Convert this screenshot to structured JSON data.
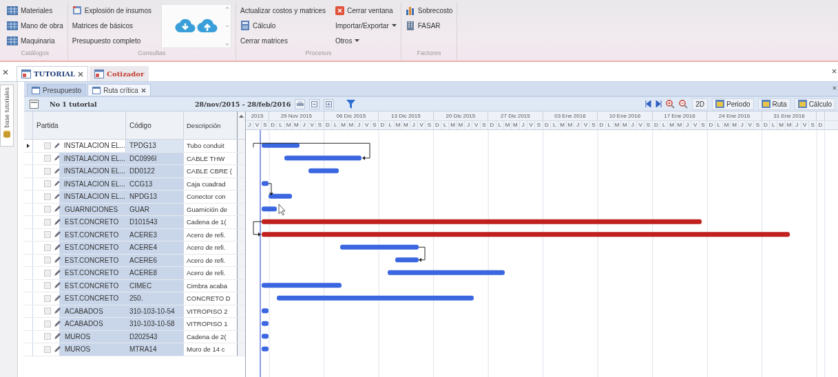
{
  "ribbon": {
    "groups": [
      {
        "label": "Catálogos",
        "items": [
          {
            "kind": "with-icon",
            "label": "Materiales"
          },
          {
            "kind": "with-icon",
            "label": "Mano de obra"
          },
          {
            "kind": "with-icon",
            "label": "Maquinaria"
          }
        ]
      },
      {
        "label": "Consultas",
        "items": [
          {
            "kind": "with-icon",
            "label": "Explosión de insumos"
          },
          {
            "kind": "plain",
            "label": "Matrices de básicos"
          },
          {
            "kind": "plain",
            "label": "Presupuesto completo"
          },
          {
            "kind": "gallery"
          }
        ]
      },
      {
        "label": "Procesos",
        "items": [
          {
            "kind": "plain",
            "label": "Actualizar costos y matrices"
          },
          {
            "kind": "with-icon",
            "label": "Cálculo"
          },
          {
            "kind": "plain",
            "label": "Cerrar matrices"
          },
          {
            "kind": "with-icon",
            "label": "Cerrar ventana"
          },
          {
            "kind": "menu",
            "label": "Importar/Exportar"
          },
          {
            "kind": "menu",
            "label": "Otros"
          }
        ]
      },
      {
        "label": "Factores",
        "items": [
          {
            "kind": "with-icon",
            "label": "Sobrecosto"
          },
          {
            "kind": "with-icon",
            "label": "FASAR"
          }
        ]
      }
    ]
  },
  "doc_tabs": [
    {
      "label": "TUTORIAL",
      "selected": true,
      "closable": true,
      "color": "#1f3c78"
    },
    {
      "label": "Cotizador",
      "selected": false,
      "closable": false,
      "color": "#c0392b"
    }
  ],
  "sub_tabs": [
    {
      "label": "Presupuesto",
      "selected": false,
      "closable": false
    },
    {
      "label": "Ruta crítica",
      "selected": true,
      "closable": true
    }
  ],
  "side_panel": {
    "label": "base tutoriales"
  },
  "toolbar": {
    "title": "No 1 tutorial",
    "date_range": "28/nov/2015 - 28/feb/2016",
    "buttons": [
      {
        "label": "2D"
      },
      {
        "label": "Periodo"
      },
      {
        "label": "Ruta"
      },
      {
        "label": "Cálculo"
      }
    ]
  },
  "table": {
    "columns": [
      "Partida",
      "Código",
      "Descripción"
    ],
    "rows": [
      {
        "partida": "INSTALACION EL...",
        "codigo": "TPDG13",
        "descripcion": "Tubo conduit",
        "selected": true,
        "checked": false,
        "critical": false
      },
      {
        "partida": "INSTALACION EL...",
        "codigo": "DC0996I",
        "descripcion": "CABLE THW",
        "selected": false,
        "checked": false,
        "critical": false
      },
      {
        "partida": "INSTALACION EL...",
        "codigo": "DD0122",
        "descripcion": "CABLE CBRE (",
        "selected": false,
        "checked": false,
        "critical": false
      },
      {
        "partida": "INSTALACION EL...",
        "codigo": "CCG13",
        "descripcion": "Caja cuadrad",
        "selected": false,
        "checked": false,
        "critical": false
      },
      {
        "partida": "INSTALACION EL...",
        "codigo": "NPDG13",
        "descripcion": "Conector con",
        "selected": false,
        "checked": false,
        "critical": false
      },
      {
        "partida": "GUARNICIONES",
        "codigo": "GUAR",
        "descripcion": "Guarnición de",
        "selected": false,
        "checked": false,
        "critical": false
      },
      {
        "partida": "EST.CONCRETO",
        "codigo": "D101543",
        "descripcion": "Cadena de 1(",
        "selected": false,
        "checked": false,
        "critical": true
      },
      {
        "partida": "EST.CONCRETO",
        "codigo": "ACERE3",
        "descripcion": "Acero de refi.",
        "selected": false,
        "checked": false,
        "critical": true
      },
      {
        "partida": "EST.CONCRETO",
        "codigo": "ACERE4",
        "descripcion": "Acero de refi.",
        "selected": false,
        "checked": false,
        "critical": false
      },
      {
        "partida": "EST.CONCRETO",
        "codigo": "ACERE6",
        "descripcion": "Acero de refi.",
        "selected": false,
        "checked": false,
        "critical": false
      },
      {
        "partida": "EST.CONCRETO",
        "codigo": "ACERE8",
        "descripcion": "Acero de refi.",
        "selected": false,
        "checked": false,
        "critical": false
      },
      {
        "partida": "EST.CONCRETO",
        "codigo": "CIMEC",
        "descripcion": "Cimbra acaba",
        "selected": false,
        "checked": false,
        "critical": false
      },
      {
        "partida": "EST.CONCRETO",
        "codigo": "250.",
        "descripcion": "CONCRETO D",
        "selected": false,
        "checked": false,
        "critical": false
      },
      {
        "partida": "ACABADOS",
        "codigo": "310-103-10-54",
        "descripcion": "VITROPISO 2",
        "selected": false,
        "checked": false,
        "critical": false
      },
      {
        "partida": "ACABADOS",
        "codigo": "310-103-10-58",
        "descripcion": "VITROPISO 1",
        "selected": false,
        "checked": false,
        "critical": false
      },
      {
        "partida": "MUROS",
        "codigo": "D202543",
        "descripcion": "Cadena de 2(",
        "selected": false,
        "checked": false,
        "critical": false
      },
      {
        "partida": "MUROS",
        "codigo": "MTRA14",
        "descripcion": "Muro de 14 c",
        "selected": false,
        "checked": false,
        "critical": false
      }
    ]
  },
  "timeline": [
    {
      "label": "2015",
      "days": [
        "J",
        "V",
        "S"
      ]
    },
    {
      "label": "29 Nov 2015",
      "days": [
        "D",
        "L",
        "M",
        "M",
        "J",
        "V",
        "S"
      ]
    },
    {
      "label": "06 Dic 2015",
      "days": [
        "D",
        "L",
        "M",
        "M",
        "J",
        "V",
        "S"
      ]
    },
    {
      "label": "13 Dic 2015",
      "days": [
        "D",
        "L",
        "M",
        "M",
        "J",
        "V",
        "S"
      ]
    },
    {
      "label": "20 Dic 2015",
      "days": [
        "D",
        "L",
        "M",
        "M",
        "J",
        "V",
        "S"
      ]
    },
    {
      "label": "27 Dic 2015",
      "days": [
        "D",
        "L",
        "M",
        "M",
        "J",
        "V",
        "S"
      ]
    },
    {
      "label": "03 Ene 2016",
      "days": [
        "D",
        "L",
        "M",
        "M",
        "J",
        "V",
        "S"
      ]
    },
    {
      "label": "10 Ene 2016",
      "days": [
        "D",
        "L",
        "M",
        "M",
        "J",
        "V",
        "S"
      ]
    },
    {
      "label": "17 Ene 2016",
      "days": [
        "D",
        "L",
        "M",
        "M",
        "J",
        "V",
        "S"
      ]
    },
    {
      "label": "24 Ene 2016",
      "days": [
        "D",
        "L",
        "M",
        "M",
        "J",
        "V",
        "S"
      ]
    },
    {
      "label": "31 Ene 2016",
      "days": [
        "D",
        "L",
        "M",
        "M",
        "J",
        "V",
        "S"
      ]
    },
    {
      "days": [
        "D"
      ]
    }
  ]
}
